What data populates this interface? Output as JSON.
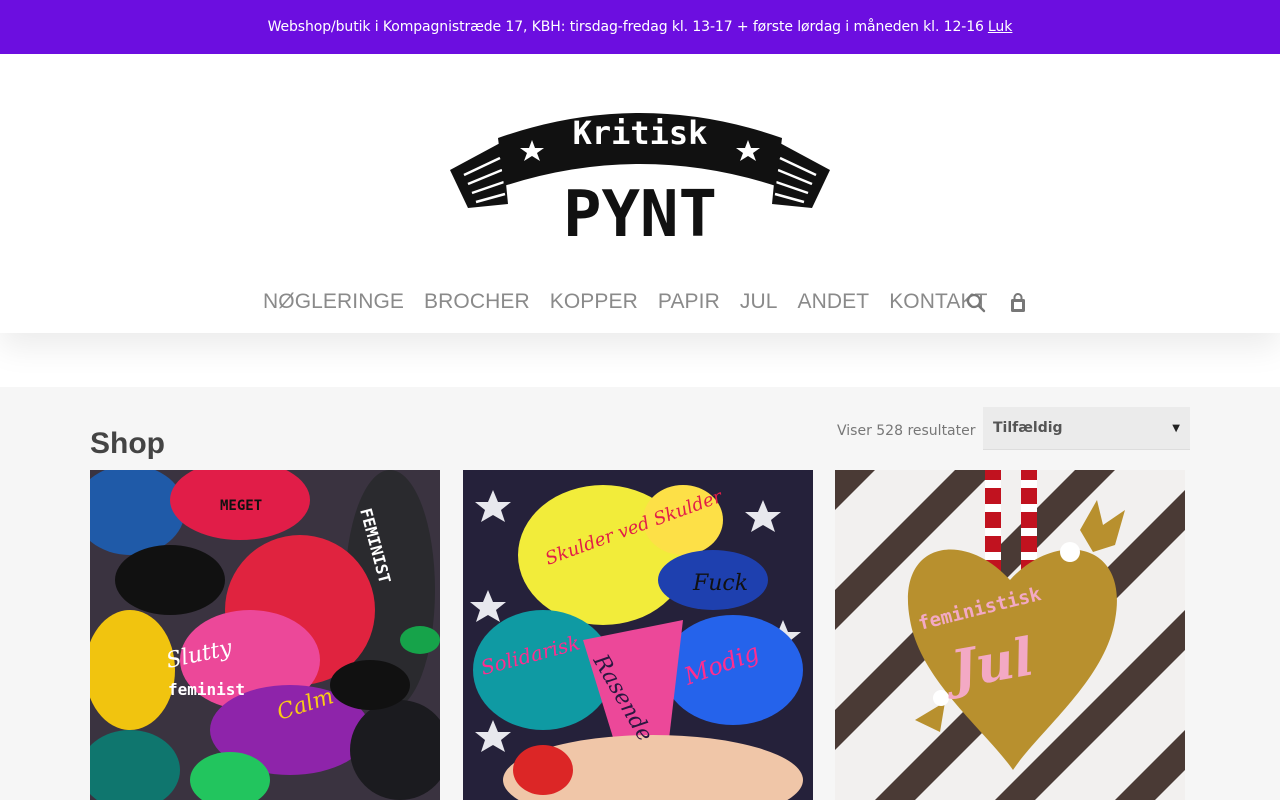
{
  "announcement": {
    "text": "Webshop/butik i Kompagnistræde 17, KBH: tirsdag-fredag kl. 13-17 + første lørdag i måneden kl. 12-16",
    "close_link": "Luk"
  },
  "logo": {
    "line1": "Kritisk",
    "line2": "PYNT"
  },
  "nav": {
    "items": [
      "NØGLERINGE",
      "BROCHER",
      "KOPPER",
      "PAPIR",
      "JUL",
      "ANDET",
      "KONTAKT"
    ]
  },
  "tools": {
    "search_icon": "search-icon",
    "cart_icon": "shopping-bag-icon"
  },
  "shop": {
    "title": "Shop",
    "result_count": "Viser 528 resultater",
    "sort_selected": "Tilfældig"
  },
  "products": [
    {
      "image_text": [
        "Slutty",
        "feminist",
        "Calm",
        "FEMINIST",
        "MEGET"
      ]
    },
    {
      "image_text": [
        "Skulder ved Skulder",
        "Solidarisk",
        "Rasende",
        "Modig",
        "Fuck"
      ]
    },
    {
      "image_text": [
        "feministisk",
        "Jul"
      ]
    }
  ]
}
